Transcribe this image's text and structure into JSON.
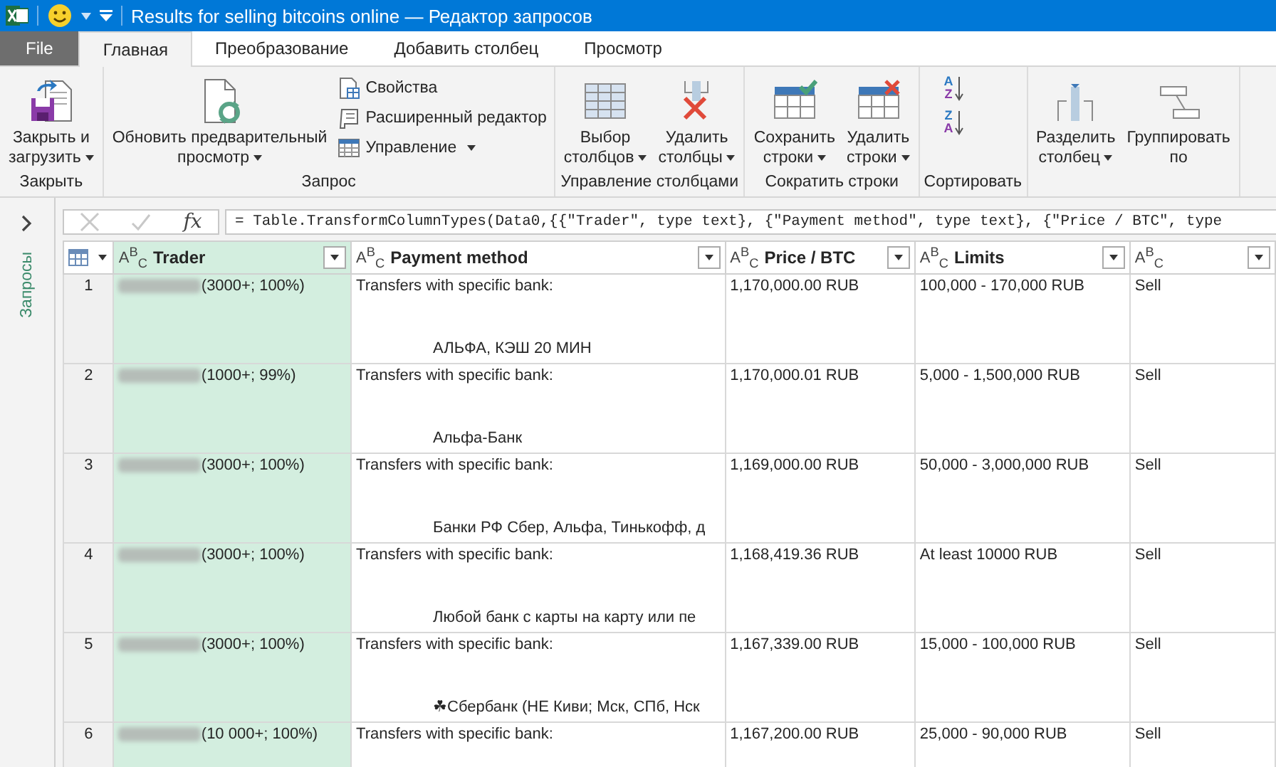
{
  "window": {
    "title": "Results for selling bitcoins online — Редактор запросов"
  },
  "tabs": [
    {
      "label": "File",
      "selected": false,
      "kind": "file"
    },
    {
      "label": "Главная",
      "selected": true,
      "kind": "tab"
    },
    {
      "label": "Преобразование",
      "selected": false,
      "kind": "tab"
    },
    {
      "label": "Добавить столбец",
      "selected": false,
      "kind": "tab"
    },
    {
      "label": "Просмотр",
      "selected": false,
      "kind": "tab"
    }
  ],
  "ribbon": {
    "groups": [
      {
        "label": "Закрыть",
        "buttons": [
          {
            "label": "Закрыть и\nзагрузить",
            "kind": "large",
            "dropdown": true
          }
        ]
      },
      {
        "label": "Запрос",
        "buttons": [
          {
            "label": "Обновить предварительный\nпросмотр",
            "kind": "large",
            "dropdown": true
          },
          {
            "label": "Свойства",
            "kind": "small",
            "dropdown": false
          },
          {
            "label": "Расширенный редактор",
            "kind": "small",
            "dropdown": false
          },
          {
            "label": "Управление",
            "kind": "small",
            "dropdown": true
          }
        ]
      },
      {
        "label": "Управление столбцами",
        "buttons": [
          {
            "label": "Выбор\nстолбцов",
            "kind": "large",
            "dropdown": true
          },
          {
            "label": "Удалить\nстолбцы",
            "kind": "large",
            "dropdown": true
          }
        ]
      },
      {
        "label": "Сократить строки",
        "buttons": [
          {
            "label": "Сохранить\nстроки",
            "kind": "large",
            "dropdown": true
          },
          {
            "label": "Удалить\nстроки",
            "kind": "large",
            "dropdown": true
          }
        ]
      },
      {
        "label": "Сортировать",
        "buttons": [
          {
            "kind": "icon",
            "letters": [
              "A",
              "Z"
            ]
          },
          {
            "kind": "icon",
            "letters": [
              "Z",
              "A"
            ]
          }
        ]
      },
      {
        "buttons": [
          {
            "label": "Разделить\nстолбец",
            "kind": "large",
            "dropdown": true
          },
          {
            "label": "Группировать\nпо",
            "kind": "large",
            "dropdown": false
          }
        ]
      }
    ]
  },
  "queries_pane": {
    "label": "Запросы"
  },
  "formula_bar": {
    "fx": "fx",
    "formula": "= Table.TransformColumnTypes(Data0,{{\"Trader\", type text}, {\"Payment method\", type text}, {\"Price / BTC\", type"
  },
  "table": {
    "columns": [
      {
        "type": "A$^{B}$$_{C}$",
        "label": "Trader",
        "selected": true
      },
      {
        "type": "A$^{B}$$_{C}$",
        "label": "Payment method",
        "selected": false
      },
      {
        "type": "A$^{B}$$_{C}$",
        "label": "Price / BTC",
        "selected": false
      },
      {
        "type": "A$^{B}$$_{C}$",
        "label": "Limits",
        "selected": false
      },
      {
        "type": "A$^{B}$$_{C}$",
        "selected": false
      }
    ],
    "rows": [
      {
        "number": "1",
        "trader": "(3000+; 100%)",
        "payment": "Transfers with specific bank:",
        "payment_detail": "АЛЬФА,  КЭШ    20 МИН",
        "price": "1,170,000.00 RUB",
        "limits": "100,000 - 170,000 RUB",
        "column_5": "Sell"
      },
      {
        "number": "2",
        "trader": "(1000+; 99%)",
        "payment": "Transfers with specific bank:",
        "payment_detail": "Альфа-Банк",
        "price": "1,170,000.01 RUB",
        "limits": "5,000 - 1,500,000 RUB",
        "column_5": "Sell"
      },
      {
        "number": "3",
        "trader": "(3000+; 100%)",
        "payment": "Transfers with specific bank:",
        "payment_detail": "Банки РФ Сбер, Альфа, Тинькофф, д",
        "price": "1,169,000.00 RUB",
        "limits": "50,000 - 3,000,000 RUB",
        "column_5": "Sell"
      },
      {
        "number": "4",
        "trader": "(3000+; 100%)",
        "payment": "Transfers with specific bank:",
        "payment_detail": "Любой банк с карты на карту или пе",
        "price": "1,168,419.36 RUB",
        "limits": "At least 10000 RUB",
        "column_5": "Sell"
      },
      {
        "number": "5",
        "trader": "(3000+; 100%)",
        "payment": "Transfers with specific bank:",
        "payment_detail": "☘Сбербанк (НЕ Киви; Мск, СПб, Нск",
        "price": "1,167,339.00 RUB",
        "limits": "15,000 - 100,000 RUB",
        "column_5": "Sell"
      },
      {
        "number": "6",
        "trader": "(10 000+; 100%)",
        "payment": "Transfers with specific bank:",
        "price": "1,167,200.00 RUB",
        "limits": "25,000 - 90,000 RUB",
        "column_5": "Sell"
      }
    ]
  }
}
